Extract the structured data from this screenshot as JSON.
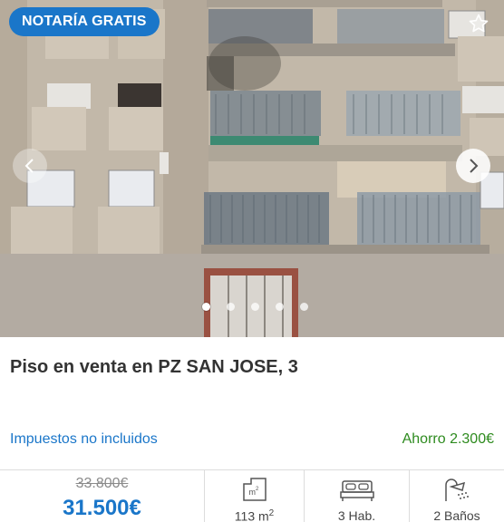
{
  "listing": {
    "badge": "NOTARÍA GRATIS",
    "title": "Piso en venta en PZ SAN JOSE, 3",
    "taxes_note": "Impuestos no incluidos",
    "saving": "Ahorro 2.300€",
    "old_price": "33.800€",
    "new_price": "31.500€",
    "photo_count": 5,
    "active_photo": 1
  },
  "features": {
    "area_value": "113 m",
    "area_unit_sup": "2",
    "rooms": "3 Hab.",
    "baths": "2 Baños"
  },
  "icons": {
    "area": "floorplan-m2-icon",
    "rooms": "bed-icon",
    "baths": "shower-icon",
    "favorite": "star-icon",
    "prev": "chevron-left-icon",
    "next": "chevron-right-icon"
  },
  "colors": {
    "accent": "#1a76c9",
    "saving": "#2e8b1f",
    "old_price": "#8a8a8a"
  }
}
